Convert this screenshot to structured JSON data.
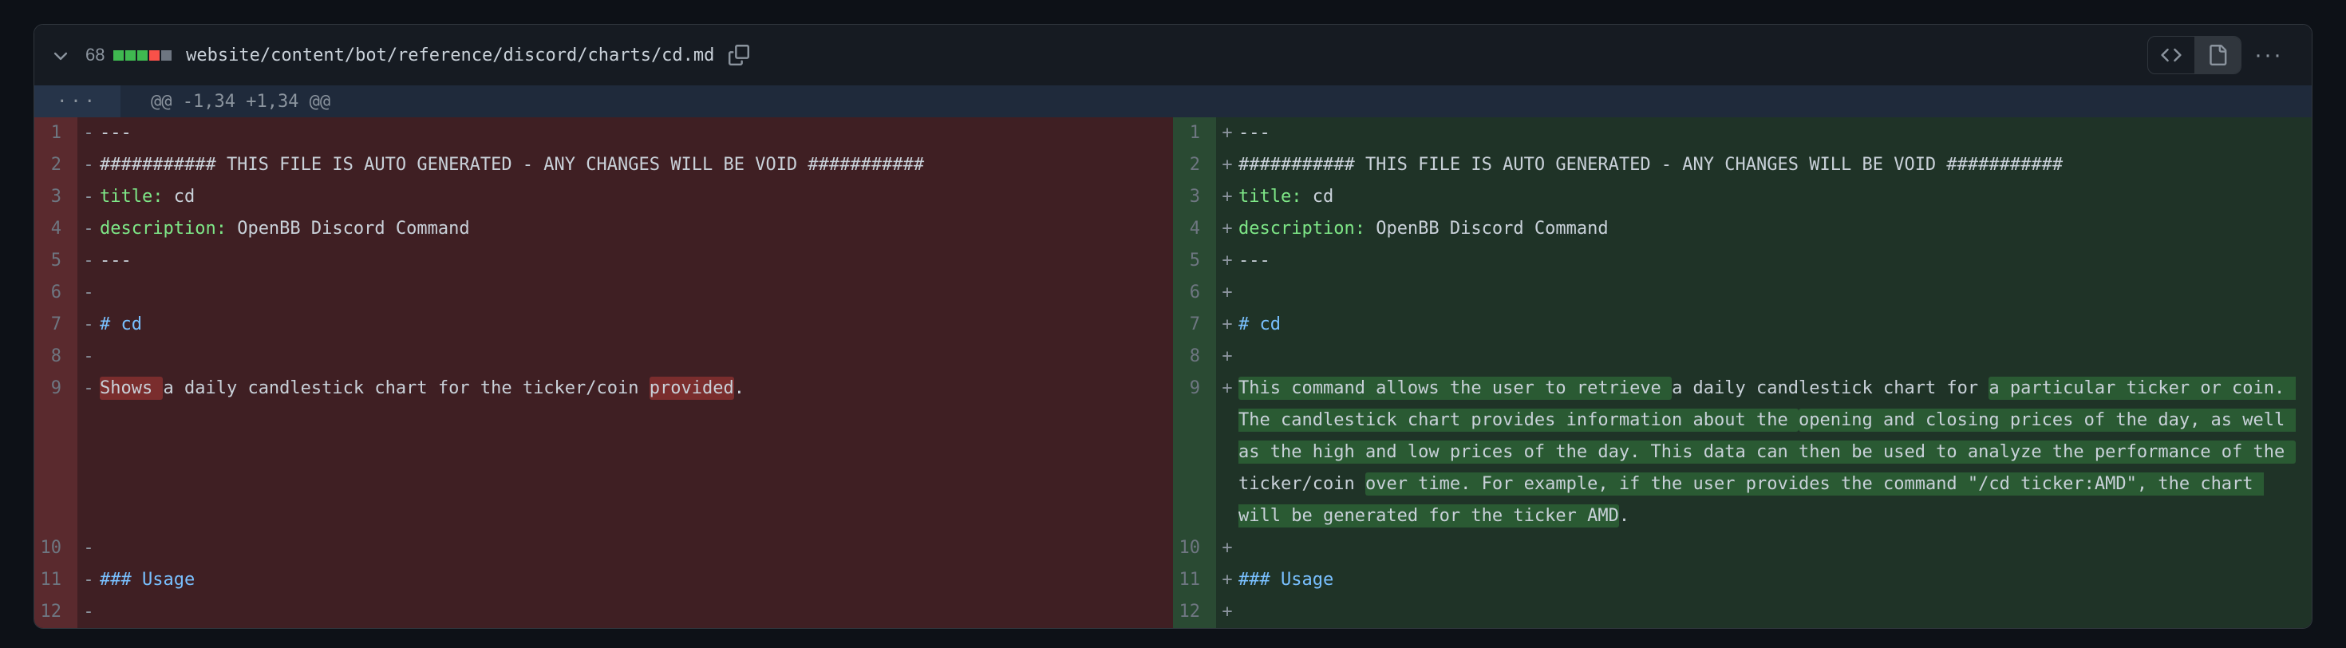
{
  "header": {
    "line_count": "68",
    "file_path": "website/content/bot/reference/discord/charts/cd.md"
  },
  "hunk": "@@ -1,34 +1,34 @@",
  "left": {
    "lines": [
      {
        "n": 1,
        "content": "---"
      },
      {
        "n": 2,
        "content": "########### THIS FILE IS AUTO GENERATED - ANY CHANGES WILL BE VOID ###########"
      },
      {
        "n": 3,
        "pre": "",
        "key": "title:",
        "val": " cd"
      },
      {
        "n": 4,
        "pre": "",
        "key": "description:",
        "val": " OpenBB Discord Command"
      },
      {
        "n": 5,
        "content": "---"
      },
      {
        "n": 6,
        "content": ""
      },
      {
        "n": 7,
        "heading": "# cd"
      },
      {
        "n": 8,
        "content": ""
      },
      {
        "n": 9,
        "segs": [
          {
            "t": "Shows ",
            "hl": true
          },
          {
            "t": "a daily candlestick chart for the ticker/coin "
          },
          {
            "t": "provided",
            "hl": true
          },
          {
            "t": "."
          }
        ]
      },
      {
        "n": 10,
        "content": ""
      },
      {
        "n": 11,
        "heading": "### Usage"
      },
      {
        "n": 12,
        "content": ""
      }
    ]
  },
  "right": {
    "lines": [
      {
        "n": 1,
        "content": "---"
      },
      {
        "n": 2,
        "content": "########### THIS FILE IS AUTO GENERATED - ANY CHANGES WILL BE VOID ###########"
      },
      {
        "n": 3,
        "pre": "",
        "key": "title:",
        "val": " cd"
      },
      {
        "n": 4,
        "pre": "",
        "key": "description:",
        "val": " OpenBB Discord Command"
      },
      {
        "n": 5,
        "content": "---"
      },
      {
        "n": 6,
        "content": ""
      },
      {
        "n": 7,
        "heading": "# cd"
      },
      {
        "n": 8,
        "content": ""
      },
      {
        "n": 9,
        "segs": [
          {
            "t": "This command allows the user to retrieve ",
            "hl": true
          },
          {
            "t": "a daily candlestick chart for "
          },
          {
            "t": "a particular ticker or coin. The candlestick chart provides information about the ",
            "hl": true
          },
          {
            "t": "opening and closing prices of the day, as well as the high and low prices of the day. This data can then be used to analyze the performance of the ",
            "hl": true
          },
          {
            "t": "ticker/coin "
          },
          {
            "t": "over time. For example, if the user provides the command \"/cd ticker:AMD\", the chart will be generated for the ticker AMD",
            "hl": true
          },
          {
            "t": "."
          }
        ]
      },
      {
        "n": 10,
        "content": ""
      },
      {
        "n": 11,
        "heading": "### Usage"
      },
      {
        "n": 12,
        "content": ""
      }
    ]
  }
}
